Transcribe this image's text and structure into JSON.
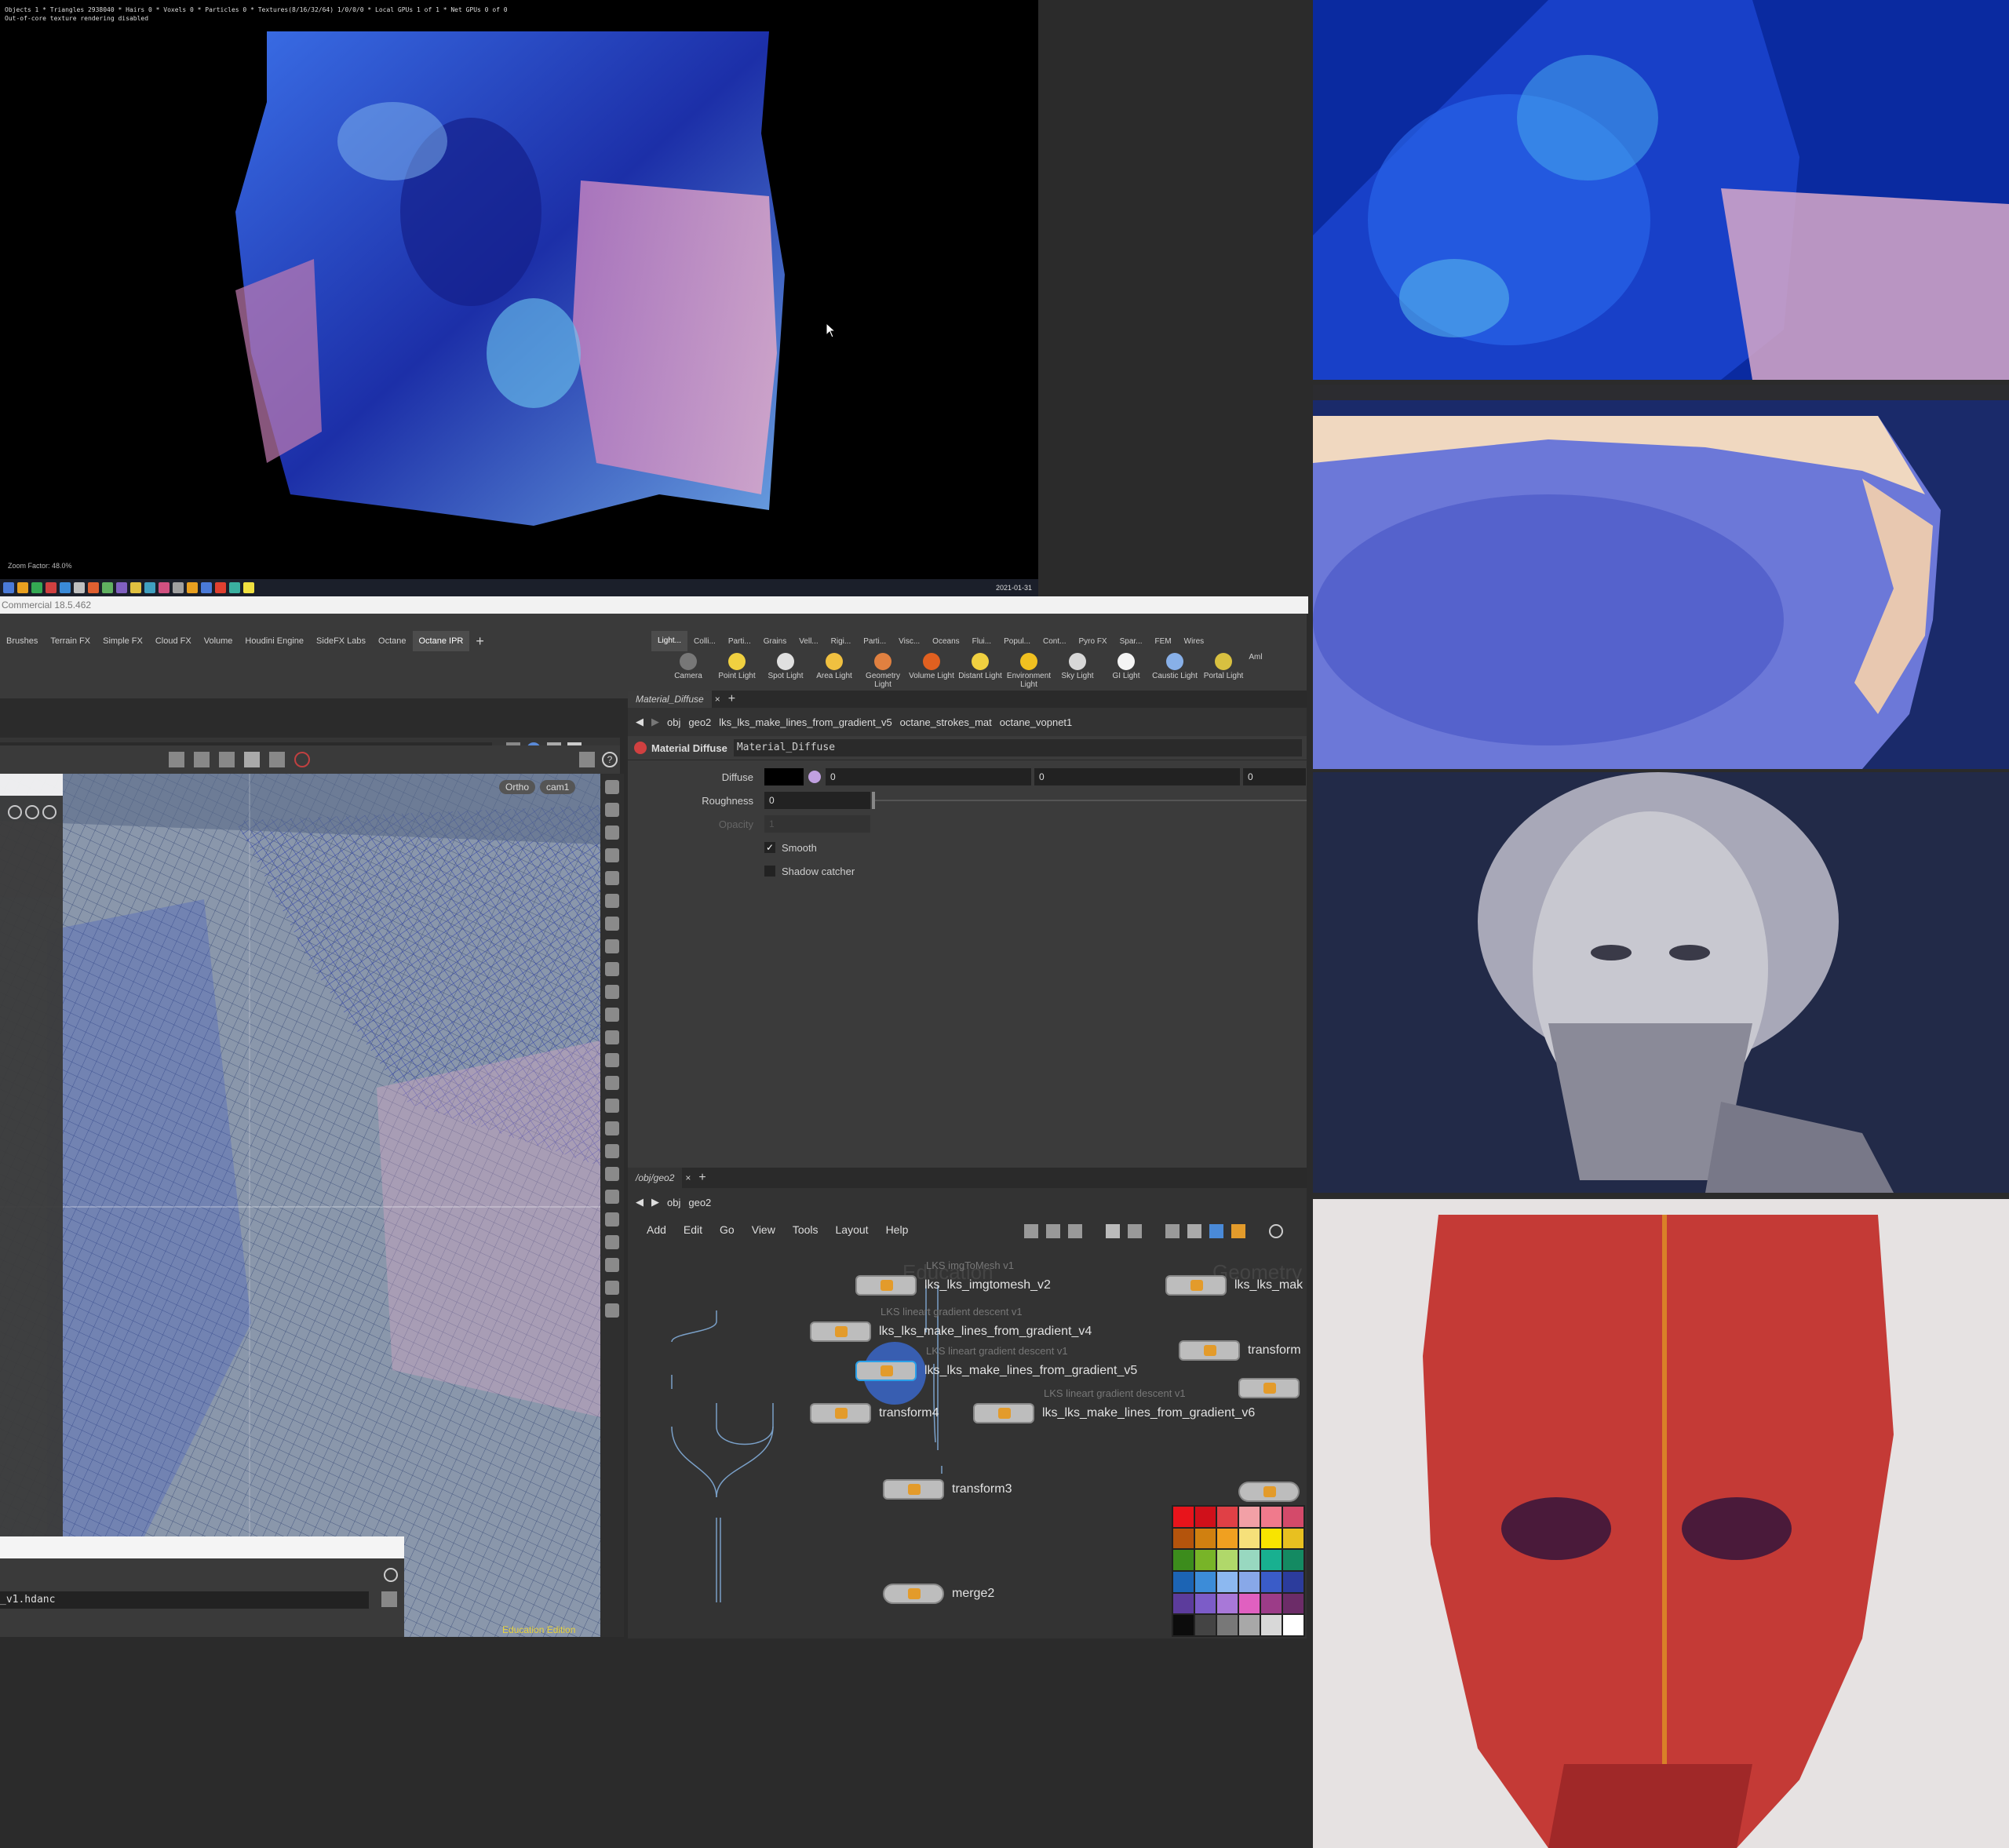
{
  "ipr": {
    "stats_line1": "Objects 1 * Triangles 2938040 * Hairs 0 * Voxels 0 * Particles 0 * Textures(8/16/32/64) 1/0/0/0 * Local GPUs 1 of 1 * Net GPUs 0 of 0",
    "stats_line2": "Out-of-core texture rendering disabled",
    "zoom": "Zoom Factor: 48.0%",
    "date": "2021-01-31"
  },
  "window_title": "Commercial 18.5.462",
  "shelf": {
    "left_tabs": [
      "Brushes",
      "Terrain FX",
      "Simple FX",
      "Cloud FX",
      "Volume",
      "Houdini Engine",
      "SideFX Labs",
      "Octane",
      "Octane IPR"
    ],
    "active_left_tab": "Octane IPR",
    "right_tabs": [
      "Light...",
      "Colli...",
      "Parti...",
      "Grains",
      "Vell...",
      "Rigi...",
      "Parti...",
      "Visc...",
      "Oceans",
      "Flui...",
      "Popul...",
      "Cont...",
      "Pyro FX",
      "Spar...",
      "FEM",
      "Wires"
    ],
    "tools": [
      "Camera",
      "Point Light",
      "Spot Light",
      "Area Light",
      "Geometry Light",
      "Volume Light",
      "Distant Light",
      "Environment Light",
      "Sky Light",
      "GI Light",
      "Caustic Light",
      "Portal Light",
      "Aml"
    ]
  },
  "viewport": {
    "path": "geo2",
    "ortho_label": "Ortho",
    "cam_label": "cam1",
    "edition": "Education Edition",
    "hda_field": "_v1.hdanc"
  },
  "params": {
    "tab_label": "Material_Diffuse",
    "breadcrumb": [
      "obj",
      "geo2",
      "lks_lks_make_lines_from_gradient_v5",
      "octane_strokes_mat",
      "octane_vopnet1"
    ],
    "node_type": "Material Diffuse",
    "node_name": "Material_Diffuse",
    "rows": {
      "diffuse_label": "Diffuse",
      "diffuse_v1": "0",
      "diffuse_v2": "0",
      "diffuse_v3": "0",
      "roughness_label": "Roughness",
      "roughness_value": "0",
      "opacity_label": "Opacity",
      "opacity_value": "1",
      "smooth_label": "Smooth",
      "shadow_label": "Shadow catcher"
    }
  },
  "network": {
    "tab_label": "/obj/geo2",
    "breadcrumb": [
      "obj",
      "geo2"
    ],
    "menu": [
      "Add",
      "Edit",
      "Go",
      "View",
      "Tools",
      "Layout",
      "Help"
    ],
    "watermark": "Education",
    "watermark2": "Geometry",
    "nodes": {
      "imgtomesh": "lks_lks_imgtomesh_v2",
      "imgtomesh_sub": "LKS imgToMesh v1",
      "grad_v4": "lks_lks_make_lines_from_gradient_v4",
      "grad_v4_sub": "LKS lineart gradient descent v1",
      "grad_v5": "lks_lks_make_lines_from_gradient_v5",
      "grad_v5_sub": "LKS lineart gradient descent v1",
      "grad_v6": "lks_lks_make_lines_from_gradient_v6",
      "grad_v6_sub": "LKS lineart gradient descent v1",
      "transform4": "transform4",
      "transform3": "transform3",
      "merge2": "merge2",
      "right_top": "lks_lks_mak",
      "right_transform": "transform"
    }
  },
  "palette": [
    "#e8141b",
    "#d0101a",
    "#e04046",
    "#f2a0a6",
    "#f07a8c",
    "#d44a6a",
    "#b4540c",
    "#d08010",
    "#f0a020",
    "#f6e07a",
    "#f8e400",
    "#e8c020",
    "#3c8c1c",
    "#78b428",
    "#b0d86a",
    "#98d8c0",
    "#18b090",
    "#148a62",
    "#1c64b4",
    "#3c8cd8",
    "#8cb8f0",
    "#88a8e8",
    "#3a5cc8",
    "#2c3c9c",
    "#5c3c9c",
    "#7c5cc8",
    "#a878d8",
    "#e060c0",
    "#9c3c88",
    "#6c2c68",
    "#0c0c0c",
    "#444444",
    "#787878",
    "#a8a8a8",
    "#d8d8d8",
    "#ffffff"
  ],
  "colors": {
    "accent": "#e39b2b",
    "node_selected": "#2aa0e8",
    "edition": "#e8d23c"
  }
}
